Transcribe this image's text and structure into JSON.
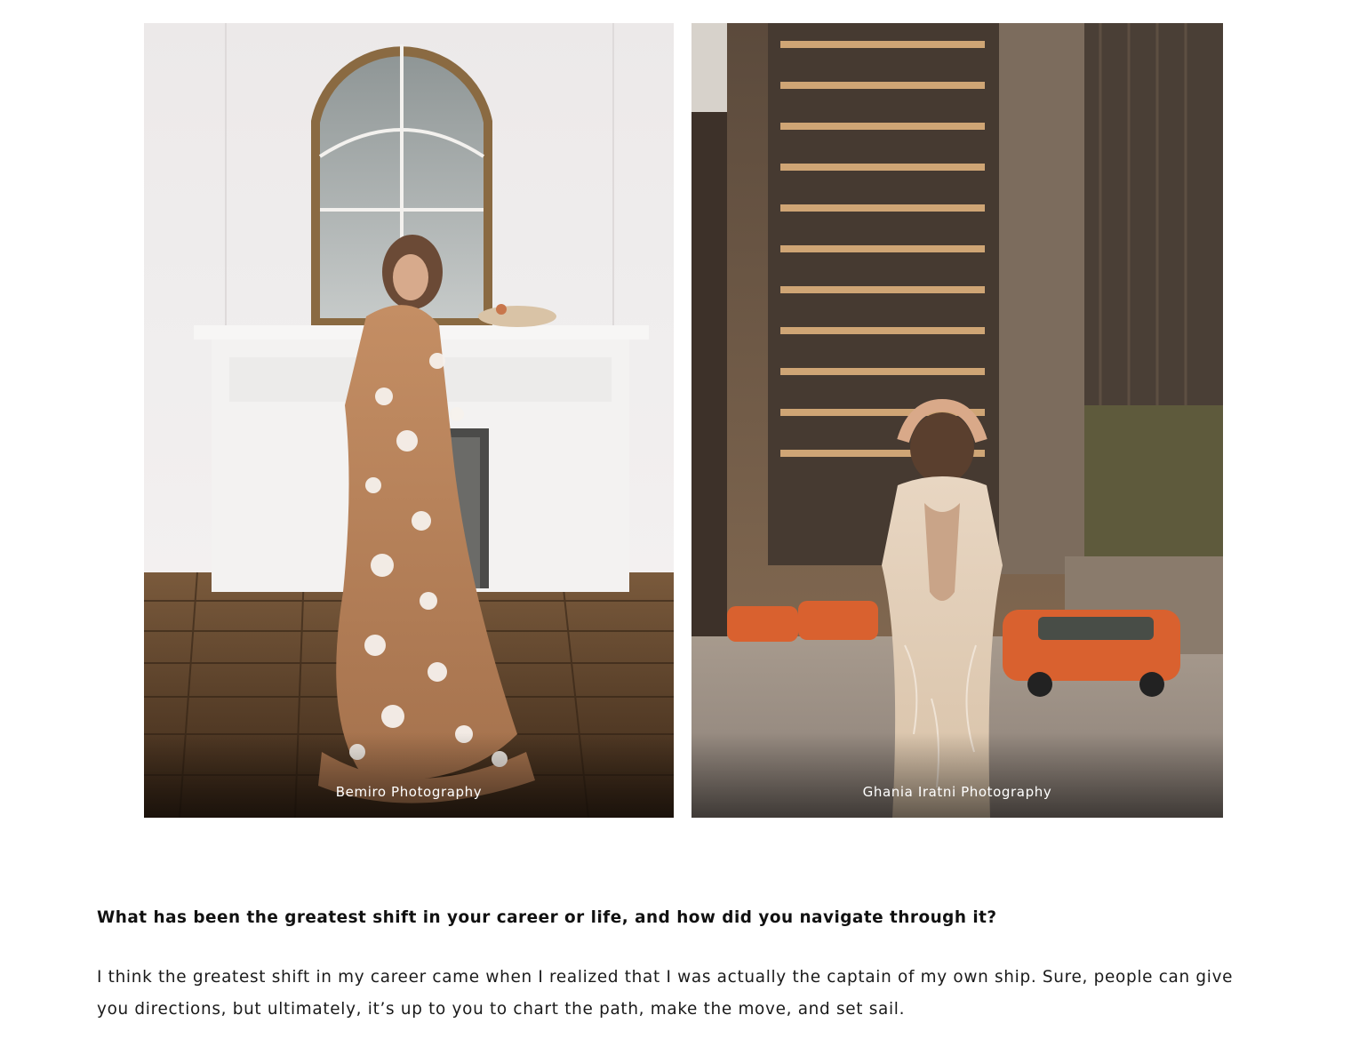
{
  "gallery": {
    "photos": [
      {
        "caption": "Bemiro Photography"
      },
      {
        "caption": "Ghania Iratni Photography"
      }
    ]
  },
  "article": {
    "question": "What has been the greatest shift in your career or life, and how did you navigate through it?",
    "answer": "I think the greatest shift in my career came when I realized that I was actually the captain of my own ship. Sure, people can give you directions, but ultimately, it’s up to you to chart the path, make the move, and set sail."
  }
}
